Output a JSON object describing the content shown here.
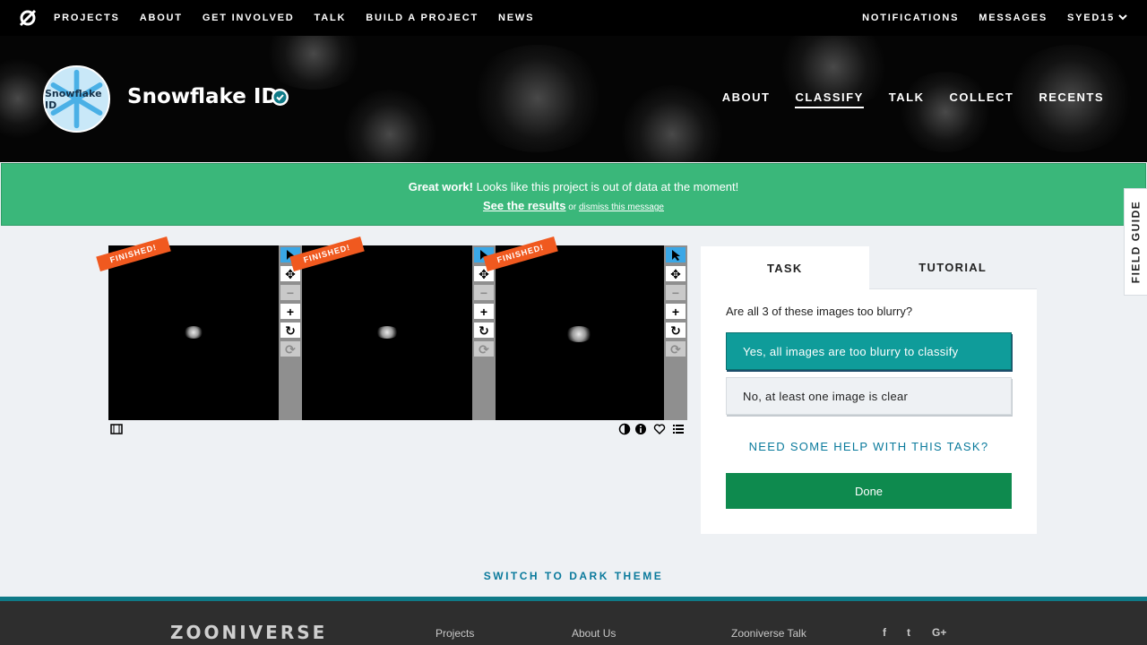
{
  "topnav": {
    "links": [
      "PROJECTS",
      "ABOUT",
      "GET INVOLVED",
      "TALK",
      "BUILD A PROJECT",
      "NEWS"
    ],
    "notifications": "NOTIFICATIONS",
    "messages": "MESSAGES",
    "user": "SYED15"
  },
  "project": {
    "avatar_text": "Snowflake ID",
    "title": "Snowflake ID",
    "nav": [
      "ABOUT",
      "CLASSIFY",
      "TALK",
      "COLLECT",
      "RECENTS"
    ],
    "active_nav": "CLASSIFY"
  },
  "banner": {
    "bold": "Great work!",
    "message": " Looks like this project is out of data at the moment!",
    "results_link": "See the results",
    "or": " or ",
    "dismiss_link": "dismiss this message",
    "color": "#3ab77a"
  },
  "field_guide": "FIELD GUIDE",
  "viewer": {
    "ribbon": "FINISHED!",
    "frames": 3
  },
  "task": {
    "tabs": [
      "TASK",
      "TUTORIAL"
    ],
    "question": "Are all 3 of these images too blurry?",
    "answers": [
      "Yes, all images are too blurry to classify",
      "No, at least one image is clear"
    ],
    "selected_answer": 0,
    "help": "NEED SOME HELP WITH THIS TASK?",
    "done": "Done"
  },
  "dark_theme": "SWITCH TO DARK THEME",
  "footer": {
    "brand": "ZOONIVERSE",
    "links": [
      "Projects",
      "About Us",
      "Zooniverse Talk"
    ],
    "social": [
      "f",
      "t",
      "G+"
    ]
  },
  "colors": {
    "accent_teal": "#0f9c9a",
    "done_green": "#0e8a4e",
    "ribbon_orange": "#f0591f",
    "link_blue": "#0a7a9c"
  }
}
